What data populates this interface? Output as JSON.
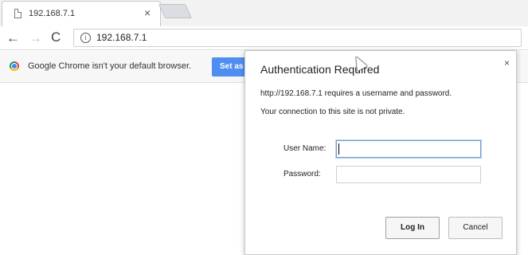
{
  "tab": {
    "title": "192.168.7.1",
    "close_glyph": "×",
    "icon": "page-icon"
  },
  "toolbar": {
    "back_glyph": "←",
    "forward_glyph": "→",
    "reload_glyph": "C",
    "info_glyph": "i",
    "url": "192.168.7.1"
  },
  "infobar": {
    "message": "Google Chrome isn't your default browser.",
    "button_label": "Set as"
  },
  "dialog": {
    "title": "Authentication Required",
    "close_glyph": "×",
    "message": "http://192.168.7.1 requires a username and password.",
    "connection_note": "Your connection to this site is not private.",
    "username_label": "User Name:",
    "username_value": "",
    "password_label": "Password:",
    "password_value": "",
    "login_label": "Log In",
    "cancel_label": "Cancel"
  },
  "colors": {
    "infobar_button": "#4d8ef0",
    "focus_border": "#6e9bd5"
  }
}
